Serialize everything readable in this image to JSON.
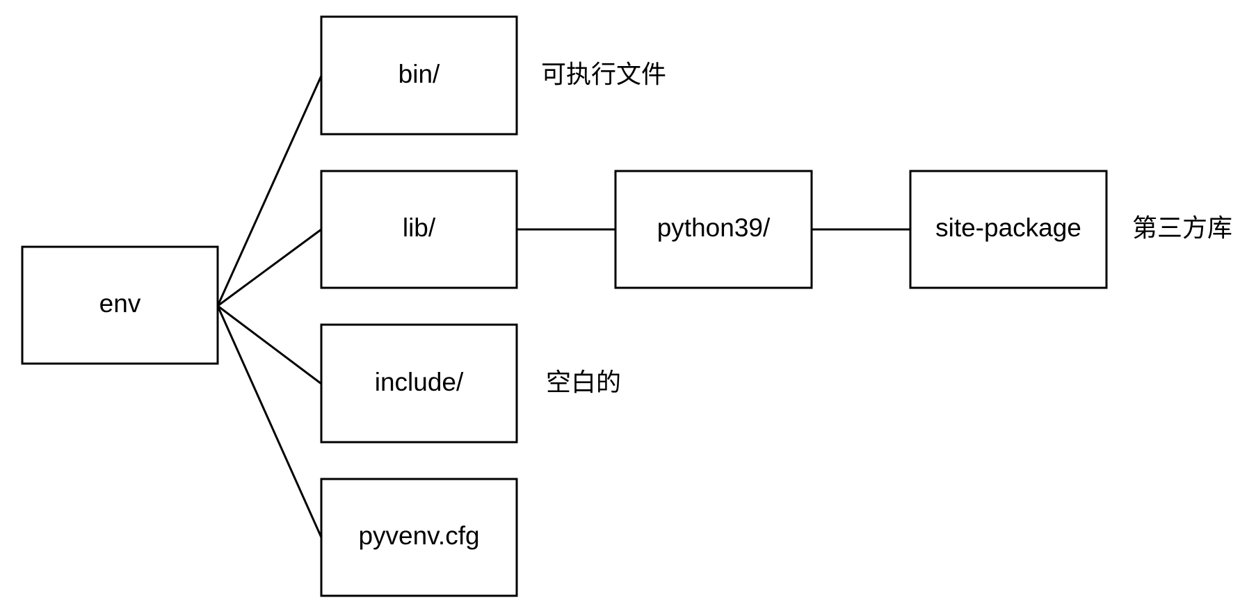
{
  "nodes": {
    "env": "env",
    "bin": "bin/",
    "lib": "lib/",
    "include": "include/",
    "pyvenv": "pyvenv.cfg",
    "python39": "python39/",
    "site_package": "site-package"
  },
  "notes": {
    "bin": "可执行文件",
    "include": "空白的",
    "site_package": "第三方库"
  },
  "colors": {
    "stroke": "#000000",
    "fill": "#ffffff"
  }
}
